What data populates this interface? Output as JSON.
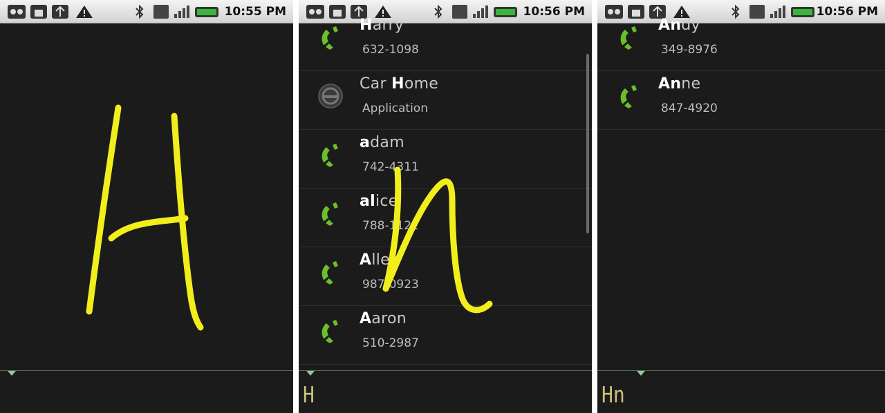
{
  "status_bar": {
    "time_1": "10:55 PM",
    "time_2": "10:56 PM",
    "time_3": "10:56 PM"
  },
  "screen_2": {
    "contacts": [
      {
        "title_bold": "H",
        "title_rest": "arry",
        "sub": "632-1098",
        "icon": "phone-icon"
      },
      {
        "title_pre": "Car ",
        "title_bold": "H",
        "title_rest": "ome",
        "sub": "Application",
        "icon": "car-home-icon"
      },
      {
        "title_bold": "a",
        "title_rest": "dam",
        "sub": "742-4311",
        "icon": "phone-icon"
      },
      {
        "title_bold": "al",
        "title_rest": "ice",
        "sub": "788-1121",
        "icon": "phone-icon"
      },
      {
        "title_bold": "A",
        "title_rest": "llen",
        "sub": "987-0923",
        "icon": "phone-icon"
      },
      {
        "title_bold": "A",
        "title_rest": "aron",
        "sub": "510-2987",
        "icon": "phone-icon"
      }
    ],
    "recognized_text": "H"
  },
  "screen_3": {
    "contacts": [
      {
        "title_bold": "An",
        "title_rest": "dy",
        "sub": "349-8976",
        "icon": "phone-icon"
      },
      {
        "title_bold": "An",
        "title_rest": "ne",
        "sub": "847-4920",
        "icon": "phone-icon"
      }
    ],
    "recognized_text": "Hn"
  },
  "colors": {
    "stroke": "#f2ee1c",
    "phone": "#6abf2a",
    "ink": "#c9c27a"
  }
}
